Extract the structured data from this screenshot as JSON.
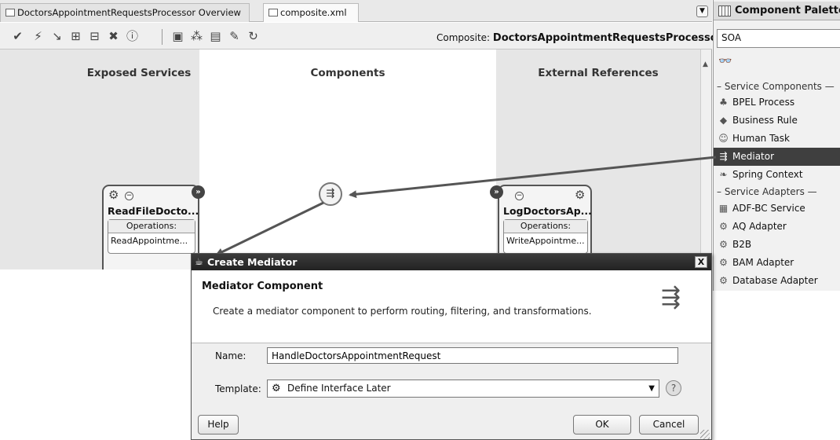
{
  "tabs": [
    {
      "label": "DoctorsAppointmentRequestsProcessor Overview"
    },
    {
      "label": "composite.xml"
    }
  ],
  "toolbar": {
    "composite_label": "Composite:",
    "composite_name": "DoctorsAppointmentRequestsProcessor",
    "icons": [
      "validate-icon",
      "deploy-icon",
      "wire-icon",
      "add-icon",
      "add-ref-icon",
      "delete-icon",
      "info-icon",
      "layout-icon",
      "tree-icon",
      "test-icon",
      "edit-icon",
      "run-icon"
    ]
  },
  "canvas": {
    "lanes": {
      "exposed": "Exposed Services",
      "components": "Components",
      "external": "External References"
    },
    "exposed_service": {
      "name": "ReadFileDocto...",
      "ops_header": "Operations:",
      "op": "ReadAppointme..."
    },
    "external_reference": {
      "name": "LogDoctorsAp...",
      "ops_header": "Operations:",
      "op": "WriteAppointme..."
    }
  },
  "palette": {
    "title": "Component Palette",
    "selector": "SOA",
    "groups": {
      "service_components": "Service Components",
      "service_adapters": "Service Adapters"
    },
    "components": [
      {
        "label": "BPEL Process",
        "icon": "bpel-icon"
      },
      {
        "label": "Business Rule",
        "icon": "rule-icon"
      },
      {
        "label": "Human Task",
        "icon": "human-icon"
      },
      {
        "label": "Mediator",
        "icon": "mediator-icon",
        "selected": true
      },
      {
        "label": "Spring Context",
        "icon": "spring-icon"
      }
    ],
    "adapters": [
      {
        "label": "ADF-BC Service",
        "icon": "adf-icon"
      },
      {
        "label": "AQ Adapter",
        "icon": "aq-icon"
      },
      {
        "label": "B2B",
        "icon": "b2b-icon"
      },
      {
        "label": "BAM Adapter",
        "icon": "bam-icon"
      },
      {
        "label": "Database Adapter",
        "icon": "db-icon"
      }
    ]
  },
  "dialog": {
    "title": "Create Mediator",
    "heading": "Mediator Component",
    "description": "Create a mediator component to perform routing, filtering, and transformations.",
    "name_label": "Name:",
    "name_value": "HandleDoctorsAppointmentRequest",
    "template_label": "Template:",
    "template_value": "Define Interface Later",
    "help": "Help",
    "ok": "OK",
    "cancel": "Cancel",
    "close": "X"
  },
  "colors": {
    "lane_gray": "#e6e6e6",
    "selection": "#3f3f3f",
    "title_bar": "#2c2c2c"
  }
}
